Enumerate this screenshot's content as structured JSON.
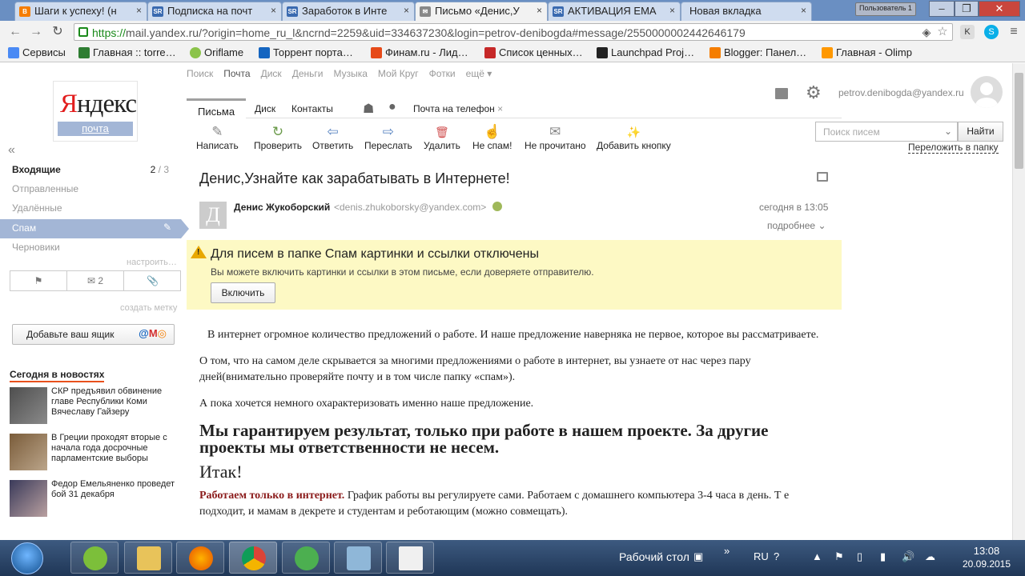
{
  "browser": {
    "tabs": [
      {
        "label": "Шаги к успеху! (н",
        "favicon": "blogger",
        "color": "#f57d00"
      },
      {
        "label": "Подписка на почт",
        "favicon": "SR",
        "color": "#3a6ab0"
      },
      {
        "label": "Заработок в Инте",
        "favicon": "SR",
        "color": "#3a6ab0"
      },
      {
        "label": "Письмо «Денис,У",
        "favicon": "mail",
        "color": "#666"
      },
      {
        "label": "АКТИВАЦИЯ ЕМА",
        "favicon": "SR",
        "color": "#3a6ab0"
      },
      {
        "label": "Новая вкладка",
        "favicon": "",
        "color": ""
      }
    ],
    "user_badge": "Пользователь 1",
    "url_https": "https://",
    "url_rest": "mail.yandex.ru/?origin=home_ru_l&ncrnd=2259&uid=334637230&login=petrov-denibogda#message/2550000002442646179",
    "bookmarks": [
      {
        "label": "Сервисы",
        "color": "#4a8af4"
      },
      {
        "label": "Главная :: torre…",
        "color": "#2e7d32"
      },
      {
        "label": "Oriflame",
        "color": "#8bc34a"
      },
      {
        "label": "Торрент порта…",
        "color": "#1565c0"
      },
      {
        "label": "Финам.ru - Лид…",
        "color": "#e64a19"
      },
      {
        "label": "Список ценных…",
        "color": "#c62828"
      },
      {
        "label": "Launchpad Proj…",
        "color": "#222"
      },
      {
        "label": "Blogger: Панел…",
        "color": "#f57d00"
      },
      {
        "label": "Главная - Olimp",
        "color": "#ff9800"
      }
    ]
  },
  "logo": {
    "brand_first": "Я",
    "brand_rest": "ндекс",
    "service": "почта"
  },
  "topnav": [
    "Поиск",
    "Почта",
    "Диск",
    "Деньги",
    "Музыка",
    "Мой Круг",
    "Фотки",
    "ещё ▾"
  ],
  "user": {
    "email": "petrov.denibogda@yandex.ru"
  },
  "subtabs": {
    "letters": "Письма",
    "disk": "Диск",
    "contacts": "Контакты",
    "phone": "Почта на телефон",
    "phone_close": "×"
  },
  "toolbar": [
    {
      "label": "Написать",
      "icon": "✎"
    },
    {
      "label": "Проверить",
      "icon": "↻"
    },
    {
      "label": "Ответить",
      "icon": "⇦"
    },
    {
      "label": "Переслать",
      "icon": "⇨"
    },
    {
      "label": "Удалить",
      "icon": "🗑"
    },
    {
      "label": "Не спам!",
      "icon": "☝"
    },
    {
      "label": "Не прочитано",
      "icon": "✉"
    },
    {
      "label": "Добавить кнопку",
      "icon": "✨"
    }
  ],
  "search": {
    "placeholder": "Поиск писем",
    "button": "Найти",
    "move": "Переложить в папку"
  },
  "folders": {
    "inbox": "Входящие",
    "inbox_count": "2",
    "inbox_total": " / 3",
    "sent": "Отправленные",
    "deleted": "Удалённые",
    "spam": "Спам",
    "drafts": "Черновики",
    "configure": "настроить…",
    "create_label": "создать метку",
    "filter_unread_count": "2"
  },
  "addbox": {
    "label": "Добавьте ваш ящик"
  },
  "news": {
    "heading": "Сегодня в новостях",
    "items": [
      "СКР предъявил обвинение главе Республики Коми Вячеславу Гайзеру",
      "В Греции проходят вторые с начала года досрочные парламентские выборы",
      "Федор Емельяненко проведет бой 31 декабря"
    ]
  },
  "message": {
    "subject": "Денис,Узнайте как зарабатывать в Интернете!",
    "sender_initial": "Д",
    "sender_name": "Денис Жукоборский",
    "sender_email": "<denis.zhukoborsky@yandex.com>",
    "date": "сегодня в 13:05",
    "details": "подробнее ⌄",
    "warn_title": "Для писем в папке Спам картинки и ссылки отключены",
    "warn_sub": "Вы можете включить картинки и ссылки в этом письме, если доверяете отправителю.",
    "warn_button": "Включить",
    "p1": "В интернет огромное количество предложений о работе. И наше предложение наверняка не первое, которое вы рассматриваете.",
    "p2": "О том, что на самом деле скрывается за многими предложениями о работе в интернет, вы узнаете от нас через пару дней(внимательно проверяйте почту и в том числе папку «спам»).",
    "p3": "А пока хочется немного охарактеризовать именно наше предложение.",
    "h": "Мы гарантируем результат, только при работе в нашем проекте. За другие проекты мы ответственности не несем.",
    "itak": "Итак!",
    "p4_red": "Работаем только в интернет.",
    "p4": " График работы вы регулируете сами. Работаем с домашнего компьютера 3-4 часа в день. Т е подходит, и мамам в декрете и студентам и реботающим (можно совмещать)."
  },
  "taskbar": {
    "desktop": "Рабочий стол",
    "lang": "RU",
    "time": "13:08",
    "date": "20.09.2015"
  }
}
